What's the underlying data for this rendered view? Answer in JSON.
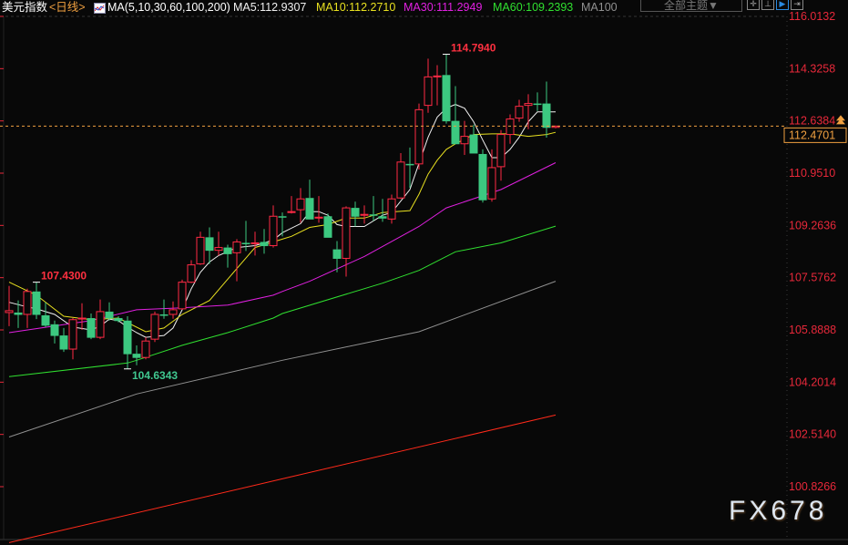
{
  "header": {
    "instrument": "美元指数",
    "period": "<日线>",
    "ma_icon": "ma-chart-icon",
    "ma_params": "MA(5,10,30,60,100,200)",
    "ma5": "MA5:112.9307",
    "ma10": "MA10:112.2710",
    "ma30": "MA30:111.2949",
    "ma60": "MA60:109.2393",
    "ma100": "MA100",
    "theme_button": "全部主题▼",
    "tools": [
      "crosshair-icon",
      "range-icon",
      "cursor-play-icon",
      "exit-icon"
    ]
  },
  "watermark": "FX678",
  "colors": {
    "up": "#ff2a45",
    "down": "#3cc880",
    "ma5": "#f0f0f0",
    "ma10": "#e8e020",
    "ma30": "#e020e0",
    "ma60": "#30e030",
    "ma100": "#909090",
    "ma200": "#ff2a1a",
    "current": "#f0a040",
    "axis": "#e8283a"
  },
  "chart_data": {
    "type": "candlestick",
    "title": "美元指数 日线",
    "yaxis_ticks": [
      "116.0132",
      "114.3258",
      "112.6384",
      "110.9510",
      "109.2636",
      "107.5762",
      "105.8888",
      "104.2014",
      "102.5140",
      "100.8266"
    ],
    "ylim": [
      100.8266,
      116.0132
    ],
    "current_price": "112.4701",
    "annotations": [
      {
        "text": "107.4300",
        "candle": 3,
        "type": "high"
      },
      {
        "text": "104.6343",
        "candle": 13,
        "type": "low"
      },
      {
        "text": "114.7940",
        "candle": 48,
        "type": "high"
      }
    ],
    "ohlc": [
      [
        106.45,
        107.31,
        106.01,
        106.51
      ],
      [
        106.45,
        106.84,
        105.95,
        106.39
      ],
      [
        106.39,
        107.22,
        105.95,
        107.13
      ],
      [
        107.13,
        107.43,
        106.24,
        106.39
      ],
      [
        106.36,
        106.78,
        105.98,
        106.04
      ],
      [
        106.07,
        106.19,
        105.45,
        105.71
      ],
      [
        105.71,
        105.95,
        105.18,
        105.27
      ],
      [
        105.27,
        106.27,
        104.94,
        106.22
      ],
      [
        106.24,
        106.75,
        105.89,
        106.27
      ],
      [
        106.27,
        106.42,
        105.59,
        105.65
      ],
      [
        105.65,
        106.87,
        105.59,
        106.48
      ],
      [
        106.48,
        106.78,
        106.19,
        106.27
      ],
      [
        106.27,
        106.33,
        106.13,
        106.19
      ],
      [
        106.19,
        106.33,
        104.63,
        105.12
      ],
      [
        105.12,
        105.39,
        104.75,
        105.0
      ],
      [
        105.0,
        105.65,
        104.94,
        105.53
      ],
      [
        105.59,
        106.48,
        105.5,
        106.39
      ],
      [
        106.39,
        106.87,
        106.25,
        106.36
      ],
      [
        106.39,
        106.81,
        106.25,
        106.54
      ],
      [
        106.57,
        107.51,
        106.54,
        107.43
      ],
      [
        107.43,
        108.14,
        107.4,
        107.99
      ],
      [
        108.02,
        109.06,
        107.99,
        108.88
      ],
      [
        108.88,
        109.2,
        108.02,
        108.46
      ],
      [
        108.46,
        109.06,
        108.29,
        108.55
      ],
      [
        108.55,
        108.64,
        107.9,
        108.35
      ],
      [
        108.38,
        108.82,
        107.46,
        108.73
      ],
      [
        108.7,
        109.41,
        108.44,
        108.67
      ],
      [
        108.67,
        109.06,
        108.29,
        108.7
      ],
      [
        108.73,
        109.15,
        108.35,
        108.61
      ],
      [
        108.61,
        109.91,
        108.55,
        109.56
      ],
      [
        109.56,
        109.68,
        108.91,
        109.53
      ],
      [
        109.68,
        110.21,
        109.65,
        109.71
      ],
      [
        109.77,
        110.47,
        109.35,
        110.12
      ],
      [
        110.15,
        110.74,
        109.47,
        109.47
      ],
      [
        109.5,
        110.21,
        109.35,
        109.53
      ],
      [
        109.56,
        109.65,
        108.88,
        108.88
      ],
      [
        108.49,
        108.76,
        107.75,
        108.2
      ],
      [
        108.2,
        109.88,
        107.61,
        109.83
      ],
      [
        109.83,
        110.03,
        109.23,
        109.56
      ],
      [
        109.59,
        109.91,
        109.32,
        109.62
      ],
      [
        109.62,
        110.21,
        109.41,
        109.59
      ],
      [
        109.56,
        110.12,
        109.38,
        109.5
      ],
      [
        109.47,
        110.26,
        109.32,
        110.12
      ],
      [
        110.15,
        111.6,
        110.12,
        111.31
      ],
      [
        111.25,
        111.78,
        110.48,
        111.22
      ],
      [
        111.25,
        113.2,
        111.07,
        113.0
      ],
      [
        113.14,
        114.65,
        112.9,
        114.06
      ],
      [
        114.06,
        114.44,
        113.14,
        114.09
      ],
      [
        114.12,
        114.79,
        112.55,
        112.64
      ],
      [
        112.64,
        113.76,
        111.9,
        111.9
      ],
      [
        111.9,
        112.64,
        111.54,
        112.14
      ],
      [
        112.2,
        112.52,
        111.6,
        111.6
      ],
      [
        111.57,
        111.72,
        110.0,
        110.09
      ],
      [
        110.12,
        111.72,
        110.03,
        111.13
      ],
      [
        111.16,
        112.34,
        110.71,
        112.2
      ],
      [
        112.2,
        112.85,
        111.9,
        112.7
      ],
      [
        112.73,
        113.32,
        112.61,
        113.11
      ],
      [
        113.14,
        113.5,
        112.37,
        113.2
      ],
      [
        113.2,
        113.56,
        112.96,
        113.17
      ],
      [
        113.2,
        113.91,
        112.1,
        112.43
      ],
      [
        112.43,
        112.49,
        112.4,
        112.47
      ]
    ],
    "ma_series": [
      {
        "name": "MA5",
        "color_key": "ma5",
        "points": [
          [
            0,
            106.78
          ],
          [
            2,
            106.63
          ],
          [
            3,
            106.57
          ],
          [
            5,
            106.39
          ],
          [
            7,
            105.98
          ],
          [
            9,
            105.89
          ],
          [
            10,
            106.01
          ],
          [
            11,
            106.24
          ],
          [
            12,
            106.19
          ],
          [
            13,
            105.98
          ],
          [
            14,
            105.8
          ],
          [
            15,
            105.65
          ],
          [
            17,
            105.71
          ],
          [
            18,
            105.95
          ],
          [
            19,
            106.54
          ],
          [
            20,
            107.22
          ],
          [
            21,
            107.75
          ],
          [
            22,
            108.08
          ],
          [
            23,
            108.29
          ],
          [
            25,
            108.55
          ],
          [
            27,
            108.61
          ],
          [
            29,
            108.79
          ],
          [
            30,
            109.03
          ],
          [
            32,
            109.32
          ],
          [
            33,
            109.71
          ],
          [
            34,
            109.71
          ],
          [
            35,
            109.59
          ],
          [
            36,
            109.29
          ],
          [
            37,
            109.23
          ],
          [
            39,
            109.23
          ],
          [
            41,
            109.59
          ],
          [
            42,
            109.68
          ],
          [
            44,
            110.42
          ],
          [
            46,
            112.11
          ],
          [
            47,
            112.76
          ],
          [
            48,
            113.05
          ],
          [
            49,
            113.17
          ],
          [
            50,
            113.05
          ],
          [
            51,
            112.61
          ],
          [
            52,
            112.02
          ],
          [
            53,
            111.45
          ],
          [
            54,
            111.45
          ],
          [
            55,
            111.72
          ],
          [
            56,
            112.11
          ],
          [
            57,
            112.61
          ],
          [
            58,
            112.93
          ],
          [
            59,
            112.93
          ],
          [
            60,
            112.93
          ]
        ]
      },
      {
        "name": "MA10",
        "color_key": "ma10",
        "points": [
          [
            0,
            107.43
          ],
          [
            3,
            107.01
          ],
          [
            6,
            106.33
          ],
          [
            9,
            106.22
          ],
          [
            12,
            106.27
          ],
          [
            15,
            105.83
          ],
          [
            17,
            105.95
          ],
          [
            19,
            106.39
          ],
          [
            22,
            106.84
          ],
          [
            25,
            107.87
          ],
          [
            27,
            108.55
          ],
          [
            30,
            108.82
          ],
          [
            31,
            108.91
          ],
          [
            33,
            109.2
          ],
          [
            35,
            109.29
          ],
          [
            37,
            109.5
          ],
          [
            39,
            109.5
          ],
          [
            41,
            109.68
          ],
          [
            44,
            109.74
          ],
          [
            45,
            110.27
          ],
          [
            46,
            110.92
          ],
          [
            47,
            111.37
          ],
          [
            48,
            111.72
          ],
          [
            49,
            111.9
          ],
          [
            50,
            112.05
          ],
          [
            51,
            112.2
          ],
          [
            53,
            112.22
          ],
          [
            55,
            112.22
          ],
          [
            57,
            112.14
          ],
          [
            59,
            112.2
          ],
          [
            60,
            112.27
          ]
        ]
      },
      {
        "name": "MA30",
        "color_key": "ma30",
        "points": [
          [
            0,
            105.8
          ],
          [
            9,
            106.19
          ],
          [
            14,
            106.54
          ],
          [
            19,
            106.6
          ],
          [
            24,
            106.69
          ],
          [
            29,
            107.01
          ],
          [
            30,
            107.13
          ],
          [
            33,
            107.46
          ],
          [
            39,
            108.26
          ],
          [
            45,
            109.23
          ],
          [
            48,
            109.83
          ],
          [
            54,
            110.42
          ],
          [
            60,
            111.29
          ]
        ]
      },
      {
        "name": "MA60",
        "color_key": "ma60",
        "points": [
          [
            0,
            104.38
          ],
          [
            13,
            104.82
          ],
          [
            14,
            104.91
          ],
          [
            19,
            105.39
          ],
          [
            24,
            105.8
          ],
          [
            29,
            106.27
          ],
          [
            30,
            106.42
          ],
          [
            41,
            107.4
          ],
          [
            45,
            107.81
          ],
          [
            49,
            108.41
          ],
          [
            54,
            108.7
          ],
          [
            60,
            109.24
          ]
        ]
      },
      {
        "name": "MA100",
        "color_key": "ma100",
        "points": [
          [
            0,
            102.43
          ],
          [
            14,
            103.82
          ],
          [
            30,
            104.91
          ],
          [
            45,
            105.83
          ],
          [
            60,
            107.46
          ]
        ]
      },
      {
        "name": "MA200",
        "color_key": "ma200",
        "points": [
          [
            0,
            99.02
          ],
          [
            30,
            101.08
          ],
          [
            60,
            103.14
          ]
        ]
      }
    ]
  }
}
